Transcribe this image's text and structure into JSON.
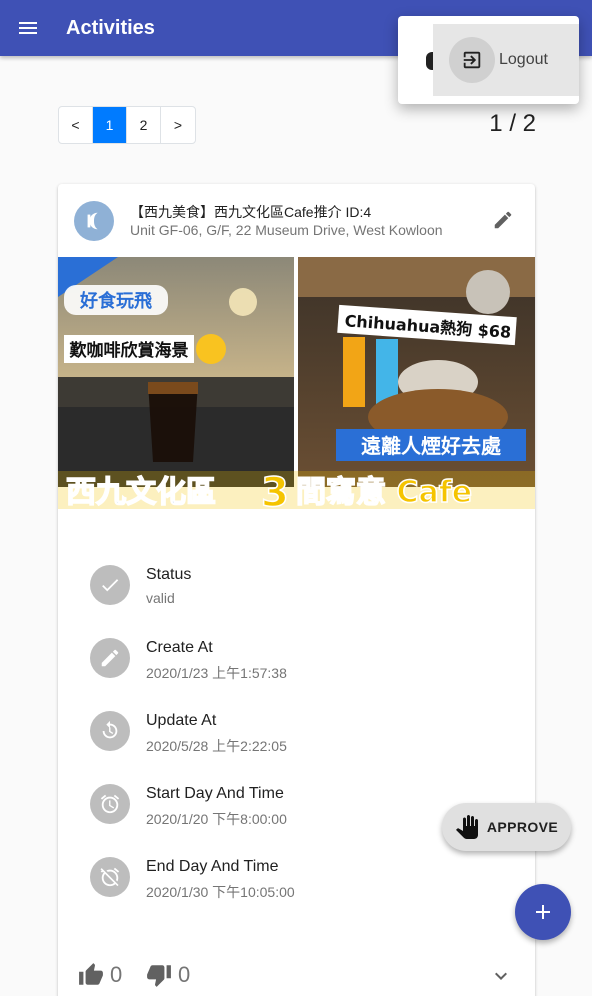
{
  "appbar": {
    "title": "Activities",
    "menu_icon": "menu-icon",
    "color": "#3f51b5"
  },
  "pagination": {
    "prev_label": "<",
    "pages": [
      "1",
      "2"
    ],
    "active_page": "1",
    "next_label": ">",
    "indicator": "1 / 2"
  },
  "activity": {
    "title": "【西九美食】西九文化區Cafe推介 ID:4",
    "subtitle": "Unit GF-06, G/F, 22 Museum Drive, West Kowloon",
    "image_texts": {
      "logo": "好食玩飛",
      "left_caption": "歎咖啡欣賞海景",
      "right_caption_top": "Chihuahua熱狗 $68",
      "right_caption_bottom": "遠離人煙好去處",
      "banner_left": "西九文化區",
      "banner_number": "3",
      "banner_right": "間寫意 Cafe"
    },
    "details": [
      {
        "label": "Status",
        "value": "valid",
        "icon": "check-icon"
      },
      {
        "label": "Create At",
        "value": "2020/1/23 上午1:57:38",
        "icon": "pencil-icon"
      },
      {
        "label": "Update At",
        "value": "2020/5/28 上午2:22:05",
        "icon": "refresh-icon"
      },
      {
        "label": "Start Day And Time",
        "value": "2020/1/20 下午8:00:00",
        "icon": "alarm-icon"
      },
      {
        "label": "End Day And Time",
        "value": "2020/1/30 下午10:05:00",
        "icon": "alarm-off-icon"
      }
    ],
    "likes": "0",
    "dislikes": "0"
  },
  "approve_button": {
    "label": "APPROVE",
    "icon": "hand-icon"
  },
  "fab": {
    "icon": "plus-icon"
  },
  "user_menu": {
    "items": [
      {
        "label": "Logout",
        "icon": "logout-icon"
      }
    ]
  }
}
